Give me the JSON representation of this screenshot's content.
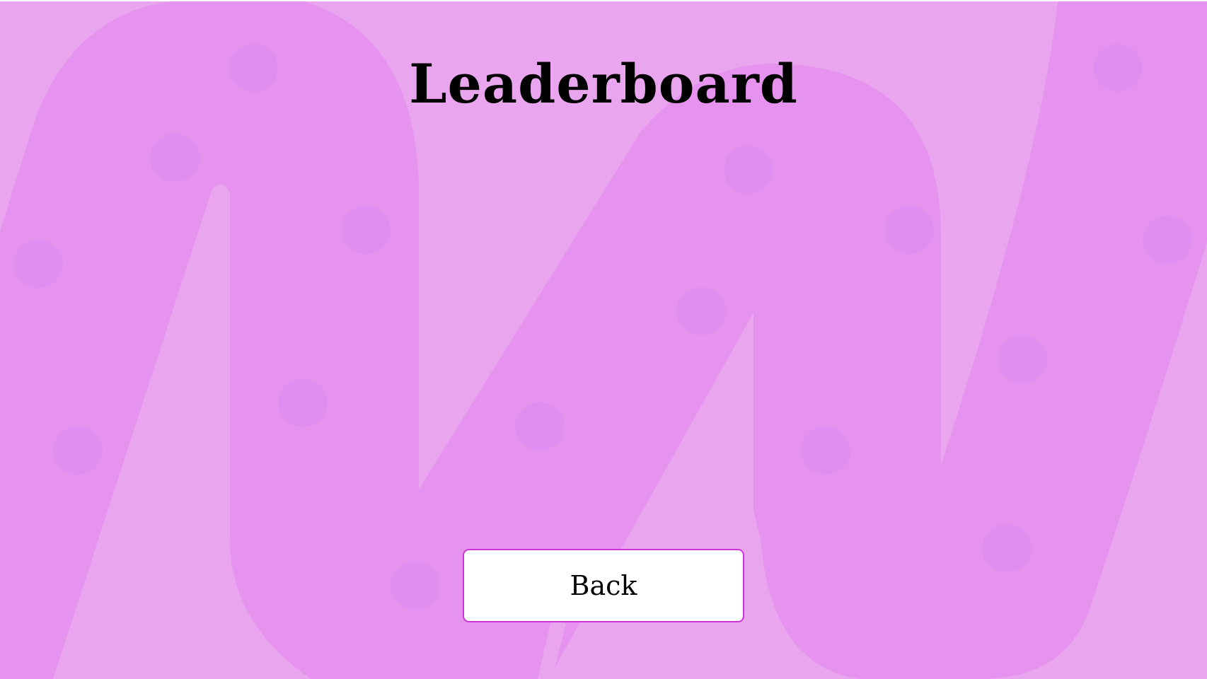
{
  "screen": {
    "title": "Leaderboard",
    "back_button_label": "Back"
  },
  "theme": {
    "background": "#e9a5ee",
    "ribbon": "#e693ef",
    "dots": "#df8ff0",
    "button_border": "#cc33dd"
  }
}
